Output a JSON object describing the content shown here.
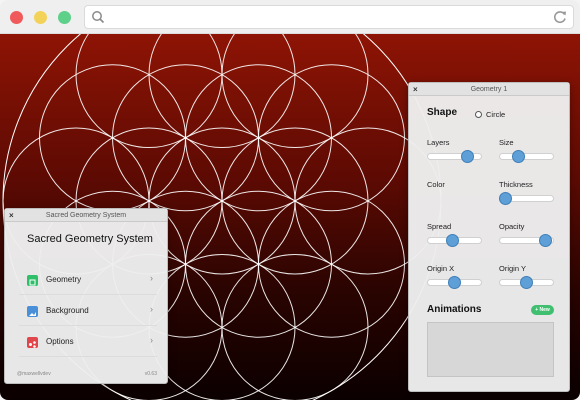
{
  "browser": {
    "search_icon": "search-icon",
    "refresh_icon": "refresh-icon"
  },
  "left_panel": {
    "window_title": "Sacred Geometry System",
    "heading": "Sacred Geometry System",
    "items": [
      {
        "label": "Geometry",
        "icon": "geometry-icon",
        "color": "#2fbf6b"
      },
      {
        "label": "Background",
        "icon": "image-icon",
        "color": "#4a90d9"
      },
      {
        "label": "Options",
        "icon": "options-icon",
        "color": "#e0464b"
      }
    ],
    "footer_left": "@maxwellvdev",
    "footer_right": "v0.63"
  },
  "right_panel": {
    "window_title": "Geometry 1",
    "shape_title": "Shape",
    "shape_option": "Circle",
    "controls": [
      {
        "label": "Layers",
        "value": 0.8
      },
      {
        "label": "Size",
        "value": 0.3
      },
      {
        "label": "Color",
        "value": null
      },
      {
        "label": "Thickness",
        "value": 0.0
      },
      {
        "label": "Spread",
        "value": 0.45
      },
      {
        "label": "Opacity",
        "value": 0.95
      },
      {
        "label": "Origin X",
        "value": 0.5
      },
      {
        "label": "Origin Y",
        "value": 0.5
      }
    ],
    "animations_title": "Animations",
    "new_button": "+ New"
  },
  "colors": {
    "accent_blue": "#5d9fd6",
    "new_button_green": "#3fbf6f",
    "background_top": "#8e1405",
    "background_bottom": "#0b0000"
  }
}
